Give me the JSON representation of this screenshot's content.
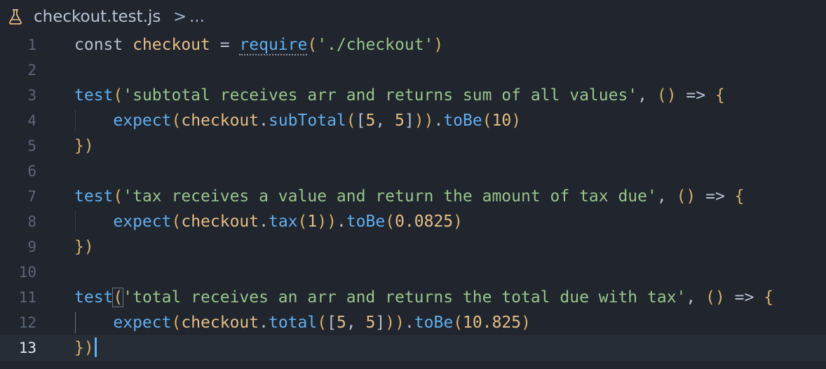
{
  "breadcrumb": {
    "icon": "flask-icon",
    "file": "checkout.test.js",
    "separator": ">",
    "more": "..."
  },
  "editor": {
    "current_line": 13,
    "lines": [
      {
        "number": "1",
        "tokens": [
          [
            "kw",
            "const "
          ],
          [
            "var",
            "checkout"
          ],
          [
            "op",
            " = "
          ],
          [
            "fn",
            "require"
          ],
          [
            "punc",
            "("
          ],
          [
            "str",
            "'./checkout'"
          ],
          [
            "punc",
            ")"
          ]
        ]
      },
      {
        "number": "2",
        "tokens": []
      },
      {
        "number": "3",
        "tokens": [
          [
            "fn",
            "test"
          ],
          [
            "punc",
            "("
          ],
          [
            "str",
            "'subtotal receives arr and returns sum of all values'"
          ],
          [
            "op",
            ", "
          ],
          [
            "punc",
            "()"
          ],
          [
            "op",
            " => "
          ],
          [
            "punc",
            "{"
          ]
        ]
      },
      {
        "number": "4",
        "tokens": [
          [
            "plain",
            "    "
          ],
          [
            "fn",
            "expect"
          ],
          [
            "punc",
            "("
          ],
          [
            "var",
            "checkout"
          ],
          [
            "op",
            "."
          ],
          [
            "fn",
            "subTotal"
          ],
          [
            "punc",
            "("
          ],
          [
            "op",
            "["
          ],
          [
            "num",
            "5"
          ],
          [
            "op",
            ", "
          ],
          [
            "num",
            "5"
          ],
          [
            "op",
            "]"
          ],
          [
            "punc",
            "))"
          ],
          [
            "op",
            "."
          ],
          [
            "fn",
            "toBe"
          ],
          [
            "punc",
            "("
          ],
          [
            "num",
            "10"
          ],
          [
            "punc",
            ")"
          ]
        ]
      },
      {
        "number": "5",
        "tokens": [
          [
            "punc",
            "})"
          ]
        ]
      },
      {
        "number": "6",
        "tokens": []
      },
      {
        "number": "7",
        "tokens": [
          [
            "fn",
            "test"
          ],
          [
            "punc",
            "("
          ],
          [
            "str",
            "'tax receives a value and return the amount of tax due'"
          ],
          [
            "op",
            ", "
          ],
          [
            "punc",
            "()"
          ],
          [
            "op",
            " => "
          ],
          [
            "punc",
            "{"
          ]
        ]
      },
      {
        "number": "8",
        "tokens": [
          [
            "plain",
            "    "
          ],
          [
            "fn",
            "expect"
          ],
          [
            "punc",
            "("
          ],
          [
            "var",
            "checkout"
          ],
          [
            "op",
            "."
          ],
          [
            "fn",
            "tax"
          ],
          [
            "punc",
            "("
          ],
          [
            "num",
            "1"
          ],
          [
            "punc",
            "))"
          ],
          [
            "op",
            "."
          ],
          [
            "fn",
            "toBe"
          ],
          [
            "punc",
            "("
          ],
          [
            "num",
            "0.0825"
          ],
          [
            "punc",
            ")"
          ]
        ]
      },
      {
        "number": "9",
        "tokens": [
          [
            "punc",
            "})"
          ]
        ]
      },
      {
        "number": "10",
        "tokens": []
      },
      {
        "number": "11",
        "tokens": [
          [
            "fn",
            "test"
          ],
          [
            "punc",
            "("
          ],
          [
            "str",
            "'total receives an arr and returns the total due with tax'"
          ],
          [
            "op",
            ", "
          ],
          [
            "punc",
            "()"
          ],
          [
            "op",
            " => "
          ],
          [
            "punc",
            "{"
          ]
        ]
      },
      {
        "number": "12",
        "tokens": [
          [
            "plain",
            "    "
          ],
          [
            "fn",
            "expect"
          ],
          [
            "punc",
            "("
          ],
          [
            "var",
            "checkout"
          ],
          [
            "op",
            "."
          ],
          [
            "fn",
            "total"
          ],
          [
            "punc",
            "("
          ],
          [
            "op",
            "["
          ],
          [
            "num",
            "5"
          ],
          [
            "op",
            ", "
          ],
          [
            "num",
            "5"
          ],
          [
            "op",
            "]"
          ],
          [
            "punc",
            "))"
          ],
          [
            "op",
            "."
          ],
          [
            "fn",
            "toBe"
          ],
          [
            "punc",
            "("
          ],
          [
            "num",
            "10.825"
          ],
          [
            "punc",
            ")"
          ]
        ]
      },
      {
        "number": "13",
        "tokens": [
          [
            "punc",
            "})"
          ]
        ]
      }
    ]
  },
  "colors": {
    "background": "#20252e",
    "current_line": "#272d37",
    "keyword": "#b7c1cf",
    "variable": "#e6bd84",
    "function": "#61aeee",
    "string": "#98c48a",
    "punctuation": "#d6b06b",
    "line_number": "#5c6777",
    "cursor": "#61aeee"
  }
}
